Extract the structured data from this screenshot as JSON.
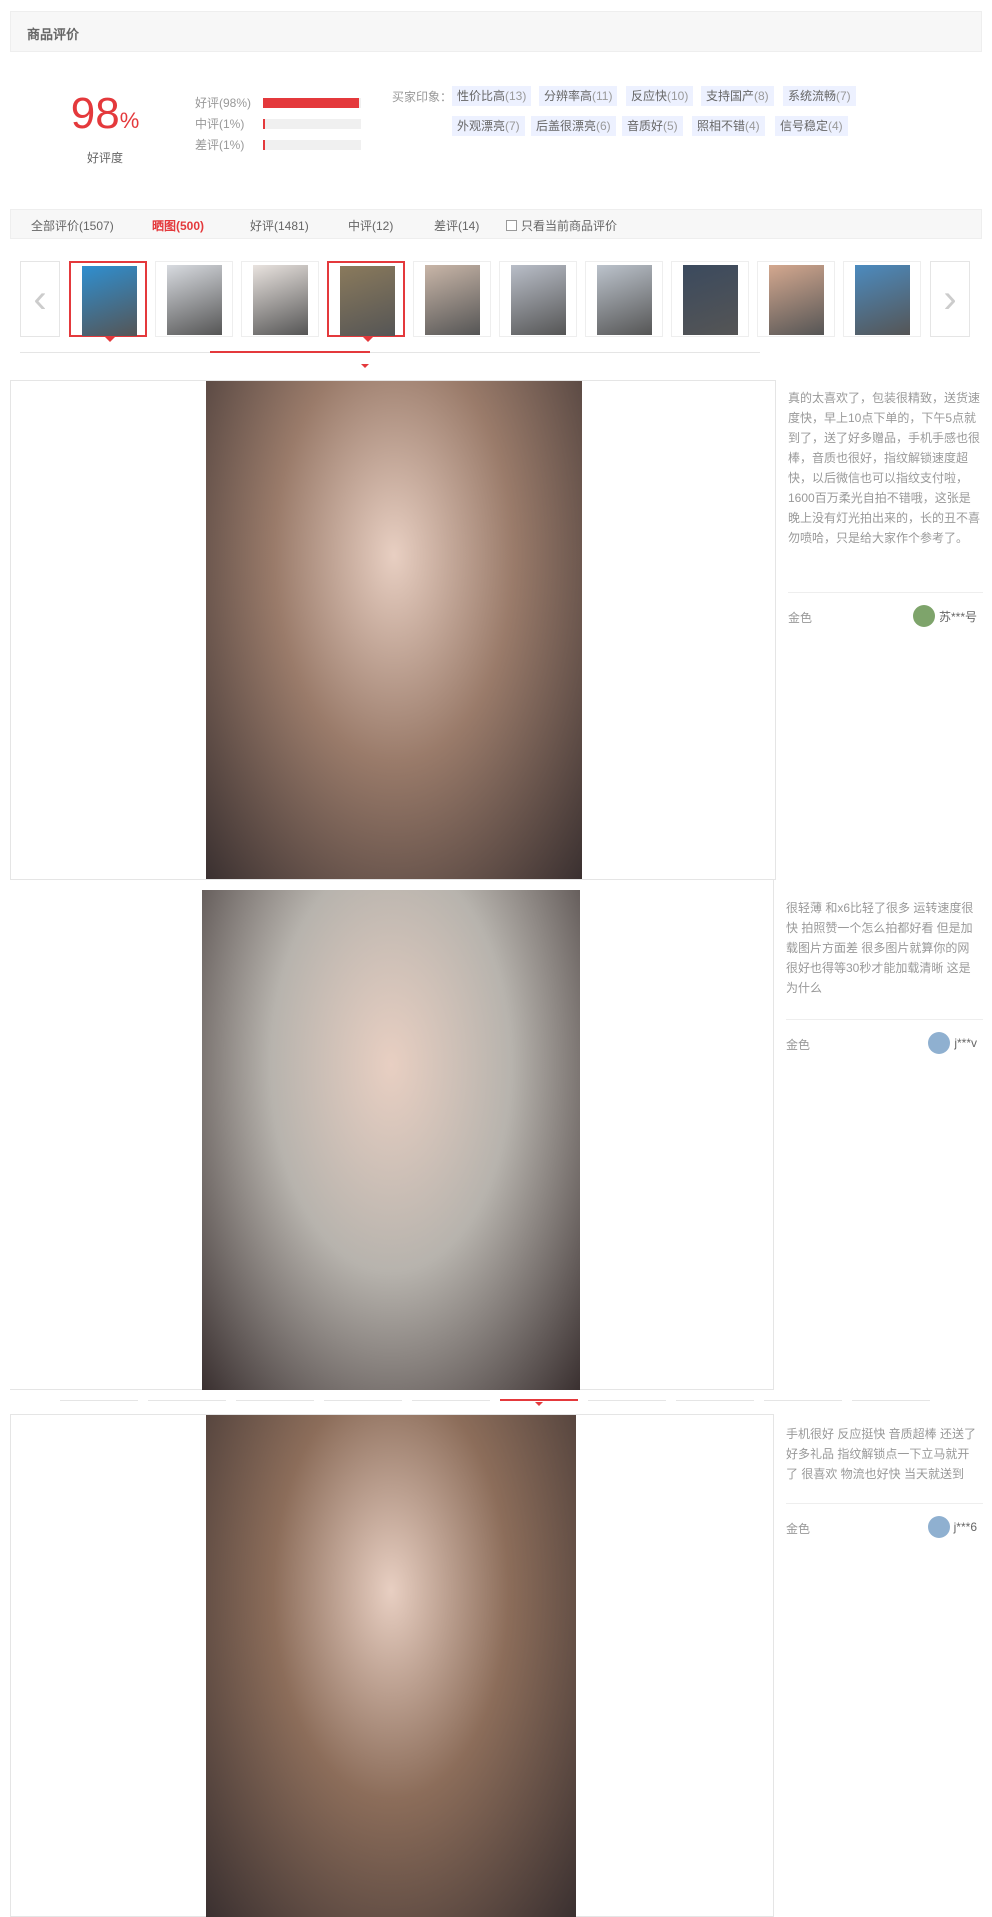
{
  "header": {
    "title": "商品评价"
  },
  "summary": {
    "rate_value": "98",
    "rate_unit": "%",
    "rate_label": "好评度",
    "bars": [
      {
        "label": "好评(98%)",
        "fraction": 0.98
      },
      {
        "label": "中评(1%)",
        "fraction": 0.01
      },
      {
        "label": "差评(1%)",
        "fraction": 0.01
      }
    ]
  },
  "impressions": {
    "label": "买家印象：",
    "tags": [
      {
        "text": "性价比高",
        "count": "(13)"
      },
      {
        "text": "分辨率高",
        "count": "(11)"
      },
      {
        "text": "反应快",
        "count": "(10)"
      },
      {
        "text": "支持国产",
        "count": "(8)"
      },
      {
        "text": "系统流畅",
        "count": "(7)"
      },
      {
        "text": "外观漂亮",
        "count": "(7)"
      },
      {
        "text": "后盖很漂亮",
        "count": "(6)"
      },
      {
        "text": "音质好",
        "count": "(5)"
      },
      {
        "text": "照相不错",
        "count": "(4)"
      },
      {
        "text": "信号稳定",
        "count": "(4)"
      }
    ]
  },
  "filters": {
    "items": [
      {
        "label": "全部评价(1507)",
        "active": false
      },
      {
        "label": "晒图(500)",
        "active": true
      },
      {
        "label": "好评(1481)",
        "active": false
      },
      {
        "label": "中评(12)",
        "active": false
      },
      {
        "label": "差评(14)",
        "active": false
      }
    ],
    "checkbox_label": "只看当前商品评价"
  },
  "thumbnails": {
    "prev_icon": "‹",
    "next_icon": "›",
    "items": [
      {
        "selected": true,
        "color": "#2f8fd0"
      },
      {
        "selected": false,
        "color": "#d8dbe0"
      },
      {
        "selected": false,
        "color": "#e9e3df"
      },
      {
        "selected": true,
        "color": "#8a7a5c"
      },
      {
        "selected": false,
        "color": "#c9b6a8"
      },
      {
        "selected": false,
        "color": "#b9bec8"
      },
      {
        "selected": false,
        "color": "#bcc3cc"
      },
      {
        "selected": false,
        "color": "#3b4a5e"
      },
      {
        "selected": false,
        "color": "#d4a88f"
      },
      {
        "selected": false,
        "color": "#4c8bbf"
      }
    ]
  },
  "reviews": [
    {
      "text": "真的太喜欢了，包装很精致，送货速度快，早上10点下单的，下午5点就到了，送了好多赠品，手机手感也很棒，音质也很好，指纹解锁速度超快，以后微信也可以指纹支付啦，1600百万柔光自拍不错哦，这张是晚上没有灯光拍出来的，长的丑不喜勿喷哈，只是给大家作个参考了。",
      "color": "金色",
      "user": "苏***号",
      "photo_color": "#9a7b6a"
    },
    {
      "text": "很轻薄 和x6比轻了很多 运转速度很快 拍照赞一个怎么拍都好看 但是加载图片方面差 很多图片就算你的网很好也得等30秒才能加载清晰 这是为什么",
      "color": "金色",
      "user": "j***v",
      "photo_color": "#b7b3ad"
    },
    {
      "text": "手机很好 反应挺快 音质超棒 还送了好多礼品 指纹解锁点一下立马就开了 很喜欢 物流也好快 当天就送到",
      "color": "金色",
      "user": "j***6",
      "photo_color": "#8c6d5a"
    }
  ]
}
